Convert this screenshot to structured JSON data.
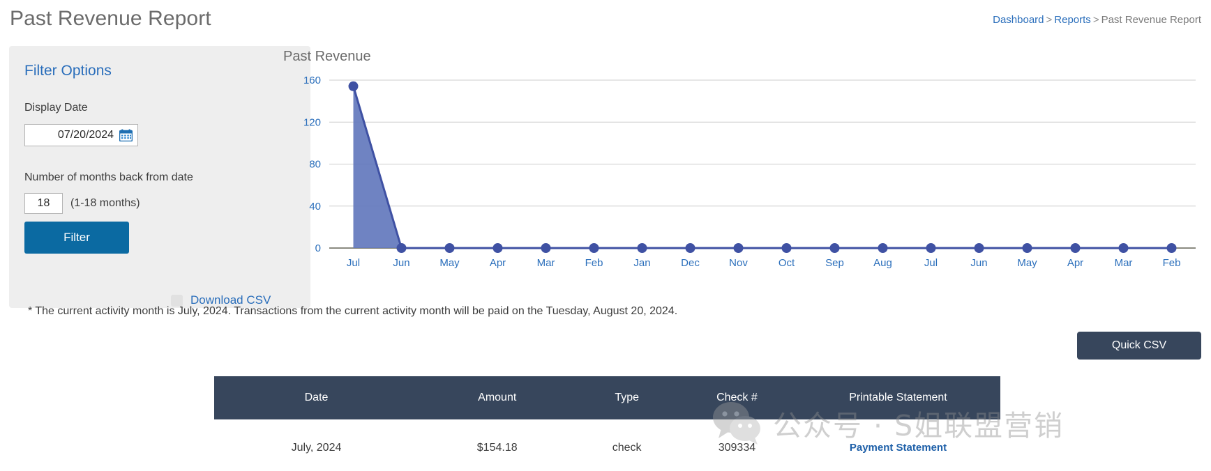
{
  "header": {
    "title": "Past Revenue Report",
    "breadcrumb": {
      "dashboard": "Dashboard",
      "reports": "Reports",
      "current": "Past Revenue Report",
      "separator": ">"
    }
  },
  "filter_panel": {
    "title": "Filter Options",
    "display_date_label": "Display Date",
    "display_date_value": "07/20/2024",
    "calendar_icon": "calendar-icon",
    "months_back_label": "Number of months back from date",
    "months_back_value": "18",
    "months_back_hint": "(1-18 months)",
    "filter_button": "Filter",
    "download_csv_label": "Download CSV",
    "download_csv_checked": false
  },
  "chart_data": {
    "type": "area",
    "title": "Past Revenue",
    "xlabel": "",
    "ylabel": "",
    "categories": [
      "Jul",
      "Jun",
      "May",
      "Apr",
      "Mar",
      "Feb",
      "Jan",
      "Dec",
      "Nov",
      "Oct",
      "Sep",
      "Aug",
      "Jul",
      "Jun",
      "May",
      "Apr",
      "Mar",
      "Feb"
    ],
    "values": [
      154.18,
      0,
      0,
      0,
      0,
      0,
      0,
      0,
      0,
      0,
      0,
      0,
      0,
      0,
      0,
      0,
      0,
      0
    ],
    "yticks": [
      0,
      40,
      80,
      120,
      160
    ],
    "ylim": [
      0,
      160
    ],
    "grid": true,
    "legend": "none",
    "series_color": "#3f51a3",
    "fill_color": "#6378bd",
    "marker": "circle"
  },
  "footnote": "* The current activity month is July, 2024. Transactions from the current activity month will be paid on the Tuesday, August 20, 2024.",
  "quick_csv_button": "Quick CSV",
  "table": {
    "columns": [
      "Date",
      "Amount",
      "Type",
      "Check #",
      "Printable Statement"
    ],
    "rows": [
      {
        "date": "July, 2024",
        "amount": "$154.18",
        "type": "check",
        "check": "309334",
        "statement": "Payment Statement"
      }
    ]
  },
  "watermark": {
    "text": "公众号 · S姐联盟营销",
    "icon": "wechat-icon"
  },
  "colors": {
    "accent_blue": "#2a6ebb",
    "button_blue": "#0b6aa2",
    "dark_slate": "#37465c",
    "chart_line": "#3f51a3",
    "chart_fill": "#6378bd",
    "panel_bg": "#eeeeee"
  }
}
